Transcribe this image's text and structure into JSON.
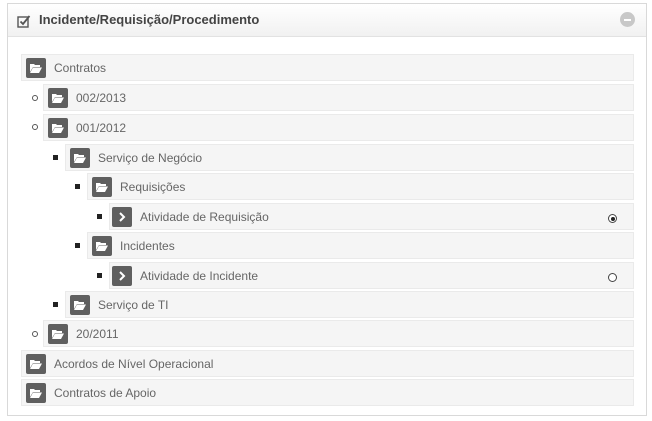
{
  "panel": {
    "title": "Incidente/Requisição/Procedimento"
  },
  "tree": {
    "contratos": "Contratos",
    "c1": "002/2013",
    "c2": "001/2012",
    "servico_negocio": "Serviço de Negócio",
    "requisicoes": "Requisições",
    "atividade_requisicao": "Atividade de Requisição",
    "incidentes": "Incidentes",
    "atividade_incidente": "Atividade de Incidente",
    "servico_ti": "Serviço de TI",
    "c3": "20/2011",
    "acordos": "Acordos de Nível Operacional",
    "contratos_apoio": "Contratos de Apoio"
  },
  "selection": {
    "atividade_requisicao_selected": true,
    "atividade_incidente_selected": false
  },
  "icons": {
    "folder": "folder-open-icon",
    "leaf": "chevron-right-icon",
    "header": "check-square-icon",
    "collapse": "minus-circle-icon"
  },
  "colors": {
    "icon_bg": "#5f5f5f",
    "row_bg": "#f5f5f5",
    "title": "#444444"
  }
}
